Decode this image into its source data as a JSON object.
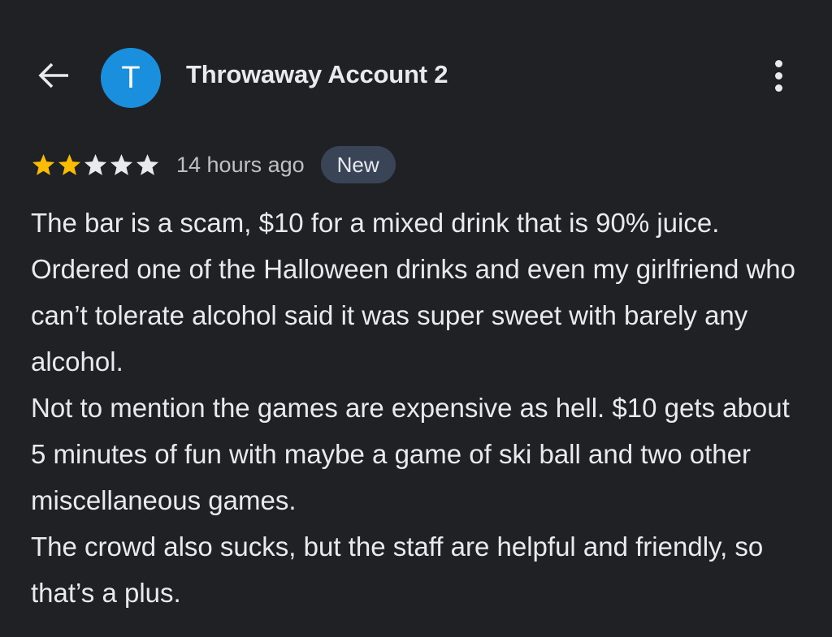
{
  "header": {
    "back_icon": "arrow-back-icon",
    "avatar_letter": "T",
    "avatar_color": "#1a8fdd",
    "author_name": "Throwaway Account 2",
    "more_icon": "more-vert-icon"
  },
  "review": {
    "rating": 2,
    "max_rating": 5,
    "star_filled_color": "#fbbc04",
    "star_empty_color": "#e8eaed",
    "time_ago": "14 hours ago",
    "badge": "New",
    "paragraphs": [
      "The bar is a scam, $10 for a mixed drink that is 90% juice. Ordered one of the Halloween drinks and even my girlfriend who can’t tolerate alcohol said it was super sweet with barely any alcohol.",
      "Not to mention the games are expensive as hell. $10 gets about 5 minutes of fun with maybe a game of ski ball and two other miscellaneous games.",
      "The crowd also sucks, but the staff are helpful and friendly, so that’s a plus."
    ]
  },
  "colors": {
    "background": "#202124",
    "text_primary": "#e8eaed",
    "text_secondary": "#bdc1c6",
    "badge_background": "#394457"
  }
}
